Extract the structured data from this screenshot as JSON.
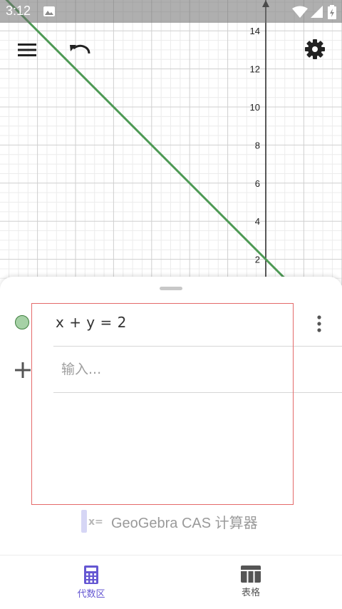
{
  "status_bar": {
    "time": "3:12"
  },
  "graph": {
    "y_ticks": [
      "2",
      "4",
      "6",
      "8",
      "10",
      "12",
      "14"
    ],
    "line_color": "#4e9a55",
    "expression": "x + y = 2"
  },
  "toolbar": {
    "menu_icon": "menu-icon",
    "undo_icon": "undo-icon",
    "settings_icon": "gear-icon"
  },
  "algebra": {
    "items": [
      {
        "expression": "x + y  =  2",
        "color": "#a6d1a6"
      }
    ],
    "input_placeholder": "输入..."
  },
  "promo": {
    "text": "GeoGebra CAS 计算器"
  },
  "bottom_nav": {
    "items": [
      {
        "label": "代数区",
        "icon": "calculator-icon",
        "active": true,
        "color": "#6557d2"
      },
      {
        "label": "表格",
        "icon": "table-icon",
        "active": false,
        "color": "#555555"
      }
    ]
  }
}
